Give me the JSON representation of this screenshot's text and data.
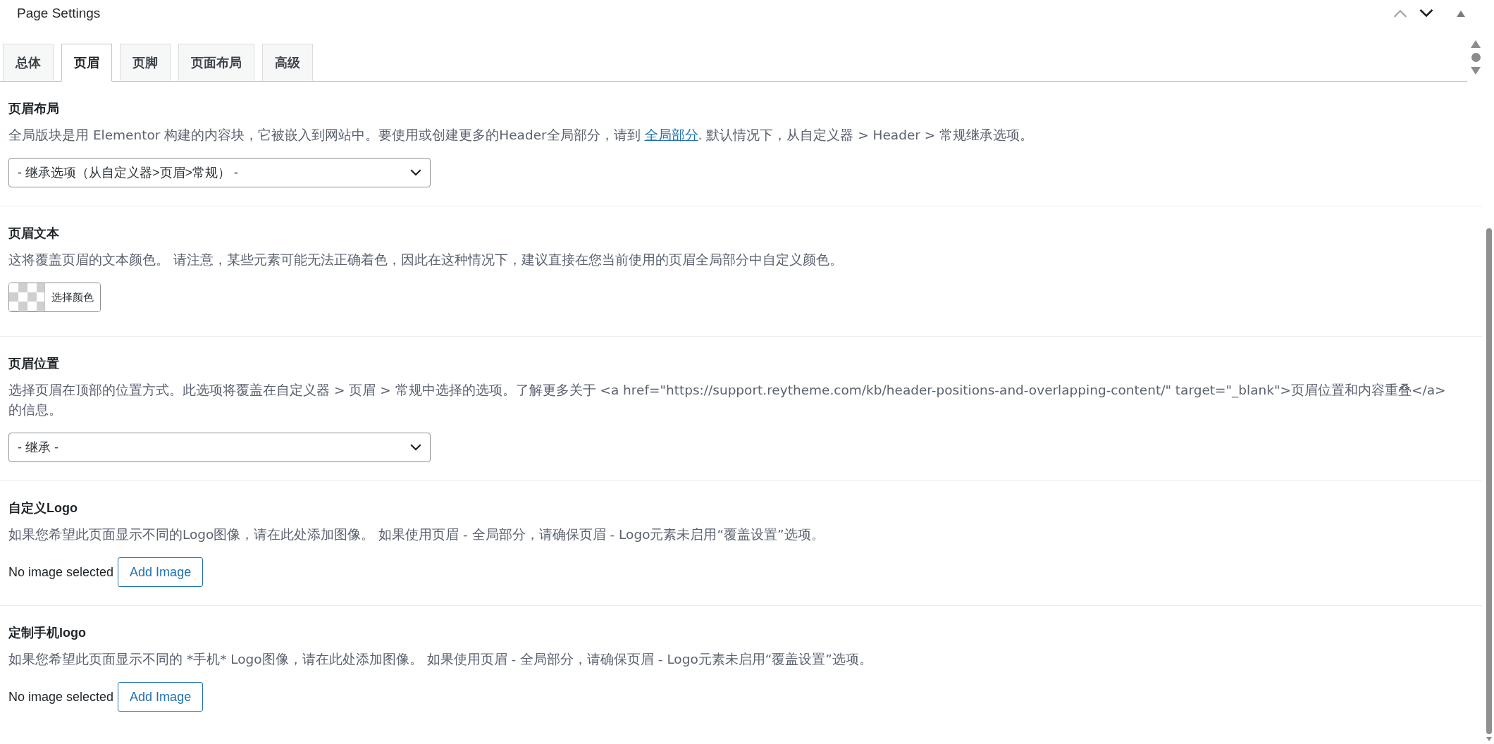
{
  "panel": {
    "title": "Page Settings",
    "move_up_disabled": true
  },
  "tabs": [
    {
      "label": "总体",
      "selected": false
    },
    {
      "label": "页眉",
      "selected": true
    },
    {
      "label": "页脚",
      "selected": false
    },
    {
      "label": "页面布局",
      "selected": false
    },
    {
      "label": "高级",
      "selected": false
    }
  ],
  "sections": [
    {
      "kind": "select",
      "label": "页眉布局",
      "description": [
        {
          "kind": "text",
          "text": "全局版块是用 Elementor 构建的内容块，它被嵌入到网站中。要使用或创建更多的Header全局部分，请到 "
        },
        {
          "kind": "link",
          "text": "全局部分"
        },
        {
          "kind": "text",
          "text": ". 默认情况下，从自定义器 > Header > 常规继承选项。"
        }
      ],
      "value": "- 继承选项（从自定义器>页眉>常规） -"
    },
    {
      "kind": "color",
      "label": "页眉文本",
      "description": [
        {
          "kind": "text",
          "text": "这将覆盖页眉的文本颜色。 请注意，某些元素可能无法正确着色，因此在这种情况下，建议直接在您当前使用的页眉全局部分中自定义颜色。"
        }
      ],
      "button": "选择颜色"
    },
    {
      "kind": "select",
      "label": "页眉位置",
      "description": [
        {
          "kind": "text",
          "text": "选择页眉在顶部的位置方式。此选项将覆盖在自定义器 > 页眉 > 常规中选择的选项。了解更多关于 <a href=\"https://support.reytheme.com/kb/header-positions-and-overlapping-content/\" target=\"_blank\">页眉位置和内容重叠</a> 的信息。"
        }
      ],
      "value": "- 继承 -"
    },
    {
      "kind": "image",
      "label": "自定义Logo",
      "description": [
        {
          "kind": "text",
          "text": "如果您希望此页面显示不同的Logo图像，请在此处添加图像。 如果使用页眉 - 全局部分，请确保页眉 - Logo元素未启用“覆盖设置”选项。"
        }
      ],
      "status": "No image selected",
      "button": "Add Image"
    },
    {
      "kind": "image",
      "label": "定制手机logo",
      "description": [
        {
          "kind": "text",
          "text": "如果您希望此页面显示不同的 *手机* Logo图像，请在此处添加图像。 如果使用页眉 - 全局部分，请确保页眉 - Logo元素未启用“覆盖设置”选项。"
        }
      ],
      "status": "No image selected",
      "button": "Add Image"
    }
  ]
}
